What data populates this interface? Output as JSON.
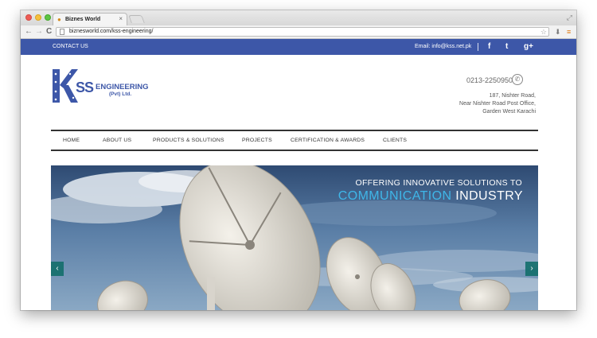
{
  "browser": {
    "tab_title": "Biznes World",
    "tab_close": "×",
    "url": "biznesworld.com/kss-engineering/",
    "back": "←",
    "forward": "→",
    "reload": "C",
    "star": "☆",
    "expand": "⤢",
    "menu": "≡",
    "extension": "⬇"
  },
  "topbar": {
    "contact": "CONTACT US",
    "email": "Email: info@kss.net.pk",
    "social": [
      "f",
      "t",
      "g+"
    ]
  },
  "logo": {
    "ss": "SS",
    "engineering": "ENGINEERING",
    "pvt": "(Pvt) Ltd."
  },
  "contact": {
    "phone": "0213-2250950",
    "address": [
      "187, Nishter Road,",
      "Near Nishter Road Post Office,",
      "Garden West Karachi"
    ]
  },
  "nav": {
    "items": [
      "HOME",
      "ABOUT US",
      "PRODUCTS & SOLUTIONS",
      "PROJECTS",
      "CERTIFICATION & AWARDS",
      "CLIENTS"
    ]
  },
  "slider": {
    "line1": "OFFERING INNOVATIVE SOLUTIONS TO",
    "highlight": "COMMUNICATION",
    "rest": " INDUSTRY",
    "prev": "‹",
    "next": "›"
  },
  "colors": {
    "brand": "#3d57a8",
    "accent": "#3fb6e8",
    "slider_arrow": "#136e6a"
  }
}
